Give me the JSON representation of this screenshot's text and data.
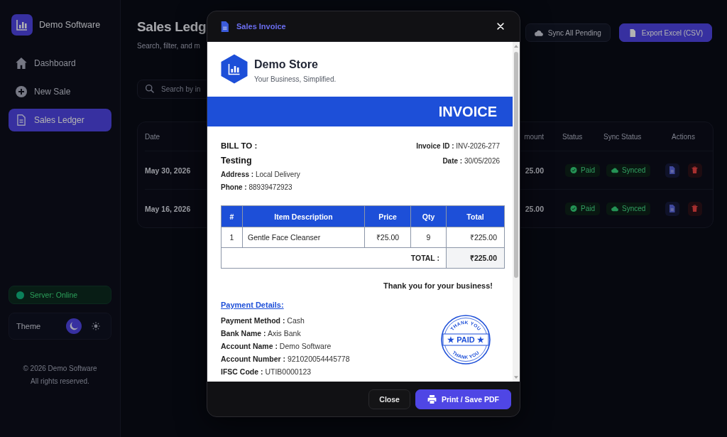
{
  "sidebar": {
    "brand": "Demo Software",
    "nav": [
      {
        "label": "Dashboard",
        "selected": false
      },
      {
        "label": "New Sale",
        "selected": false
      },
      {
        "label": "Sales Ledger",
        "selected": true
      }
    ],
    "server_status": {
      "label": "Server: Online",
      "online": true
    },
    "theme": {
      "label": "Theme",
      "options": [
        {
          "selected": true
        },
        {
          "selected": false
        }
      ]
    },
    "footer": [
      "© 2026 Demo Software",
      "All rights reserved."
    ]
  },
  "ledger": {
    "title": "Sales Ledg",
    "subtitle": "Search, filter, and m",
    "actions": [
      {
        "label": "Sync All Pending",
        "kind": "secondary"
      },
      {
        "label": "Export Excel (CSV)",
        "kind": "primary"
      }
    ],
    "search": {
      "placeholder": "Search by in"
    },
    "table": {
      "columns": [
        "Date",
        "mount",
        "Status",
        "Sync Status",
        "Actions"
      ],
      "rows": [
        {
          "date": "May 30, 2026",
          "amount": "25.00",
          "status": "Paid",
          "sync_status": "Synced"
        },
        {
          "date": "May 16, 2026",
          "amount": "25.00",
          "status": "Paid",
          "sync_status": "Synced"
        }
      ]
    }
  },
  "modal": {
    "title": "Sales Invoice",
    "invoice": {
      "store_name": "Demo Store",
      "tagline": "Your Business, Simplified.",
      "heading": "INVOICE",
      "bill_to": {
        "label": "BILL TO :",
        "name": "Testing",
        "lines": [
          "**Address :** Local Delivery",
          "**Phone :** 88939472923"
        ]
      },
      "meta": [
        "**Invoice ID :** INV-2026-277",
        "**Date :** 30/05/2026"
      ],
      "items": {
        "columns": [
          "#",
          "Item Description",
          "Price",
          "Qty",
          "Total"
        ],
        "rows": [
          [
            "1",
            "Gentle Face Cleanser",
            "₹25.00",
            "9",
            "₹225.00"
          ]
        ],
        "total_label": "TOTAL :",
        "total": "₹225.00"
      },
      "thanks": "Thank you for your business!",
      "payment": {
        "heading": "Payment Details:",
        "lines": [
          "**Payment Method :**  Cash",
          "**Bank Name :**  Axis Bank",
          "**Account Name :** Demo Software",
          "**Account Number :**  921020054445778",
          "**IFSC Code :**  UTIB0000123"
        ]
      },
      "stamp": {
        "top": "THANK YOU",
        "label": "★ PAID ★",
        "bottom": "THANK YOU"
      }
    },
    "buttons": [
      {
        "label": "Close",
        "kind": "secondary"
      },
      {
        "label": "Print / Save PDF",
        "kind": "primary"
      }
    ]
  }
}
